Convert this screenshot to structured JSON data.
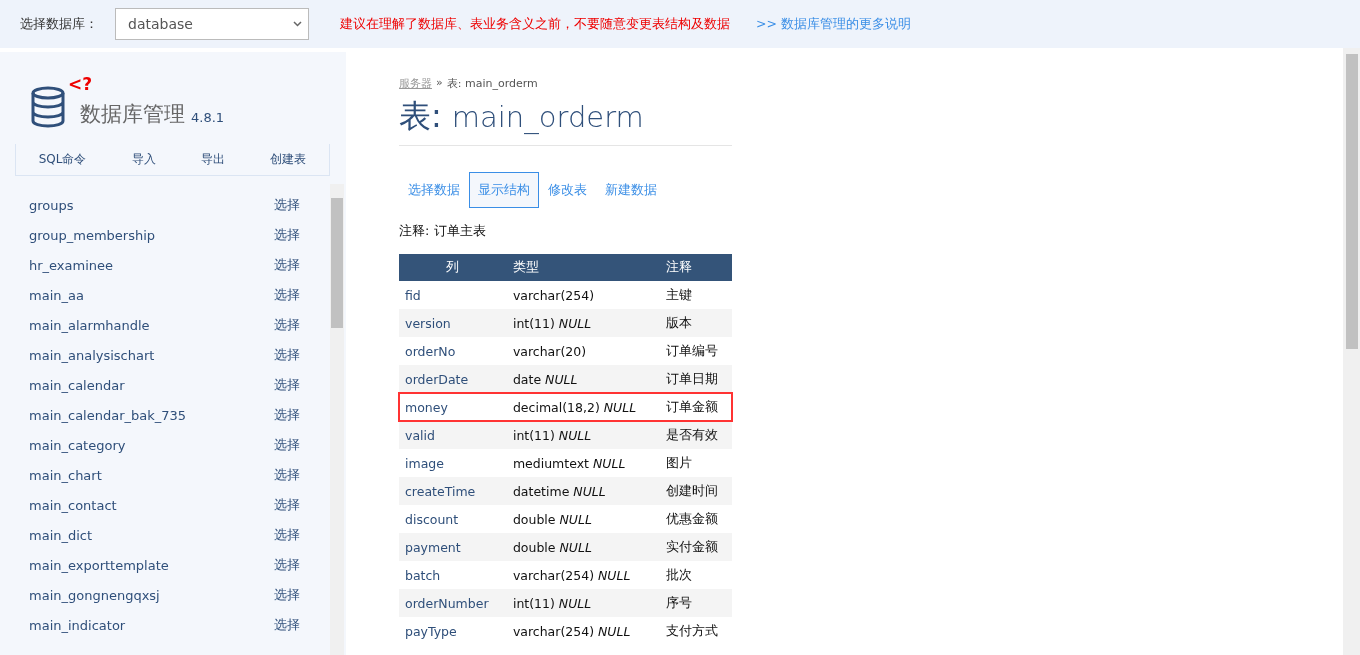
{
  "topbar": {
    "db_label": "选择数据库：",
    "db_select": {
      "value": "database"
    },
    "warning": "建议在理解了数据库、表业务含义之前，不要随意变更表结构及数据",
    "help_link": ">> 数据库管理的更多说明"
  },
  "sidebar": {
    "logo_badge": "<?",
    "title": "数据库管理",
    "version": "4.8.1",
    "actions": [
      "SQL命令",
      "导入",
      "导出",
      "创建表"
    ],
    "tables": [
      {
        "name": "groups",
        "action": "选择"
      },
      {
        "name": "group_membership",
        "action": "选择"
      },
      {
        "name": "hr_examinee",
        "action": "选择"
      },
      {
        "name": "main_aa",
        "action": "选择"
      },
      {
        "name": "main_alarmhandle",
        "action": "选择"
      },
      {
        "name": "main_analysischart",
        "action": "选择"
      },
      {
        "name": "main_calendar",
        "action": "选择"
      },
      {
        "name": "main_calendar_bak_735",
        "action": "选择"
      },
      {
        "name": "main_category",
        "action": "选择"
      },
      {
        "name": "main_chart",
        "action": "选择"
      },
      {
        "name": "main_contact",
        "action": "选择"
      },
      {
        "name": "main_dict",
        "action": "选择"
      },
      {
        "name": "main_exporttemplate",
        "action": "选择"
      },
      {
        "name": "main_gongnengqxsj",
        "action": "选择"
      },
      {
        "name": "main_indicator",
        "action": "选择"
      }
    ]
  },
  "main": {
    "breadcrumb": {
      "link": "服务器",
      "separator": "»",
      "current": "表: main_orderm"
    },
    "title": {
      "prefix": "表:",
      "name": "main_orderm"
    },
    "tabs": [
      {
        "label": "选择数据",
        "selected": false
      },
      {
        "label": "显示结构",
        "selected": true
      },
      {
        "label": "修改表",
        "selected": false
      },
      {
        "label": "新建数据",
        "selected": false
      }
    ],
    "comment": "注释: 订单主表",
    "table": {
      "columns": [
        "列",
        "类型",
        "注释"
      ],
      "rows": [
        {
          "column": "fid",
          "type": "varchar(254)",
          "comment": "主键",
          "highlighted": false
        },
        {
          "column": "version",
          "type": "int(11) *NULL*",
          "comment": "版本",
          "highlighted": false
        },
        {
          "column": "orderNo",
          "type": "varchar(20)",
          "comment": "订单编号",
          "highlighted": false
        },
        {
          "column": "orderDate",
          "type": "date *NULL*",
          "comment": "订单日期",
          "highlighted": false
        },
        {
          "column": "money",
          "type": "decimal(18,2) *NULL*",
          "comment": "订单金额",
          "highlighted": true
        },
        {
          "column": "valid",
          "type": "int(11) *NULL*",
          "comment": "是否有效",
          "highlighted": false
        },
        {
          "column": "image",
          "type": "mediumtext *NULL*",
          "comment": "图片",
          "highlighted": false
        },
        {
          "column": "createTime",
          "type": "datetime *NULL*",
          "comment": "创建时间",
          "highlighted": false
        },
        {
          "column": "discount",
          "type": "double *NULL*",
          "comment": "优惠金额",
          "highlighted": false
        },
        {
          "column": "payment",
          "type": "double *NULL*",
          "comment": "实付金额",
          "highlighted": false
        },
        {
          "column": "batch",
          "type": "varchar(254) *NULL*",
          "comment": "批次",
          "highlighted": false
        },
        {
          "column": "orderNumber",
          "type": "int(11) *NULL*",
          "comment": "序号",
          "highlighted": false
        },
        {
          "column": "payType",
          "type": "varchar(254) *NULL*",
          "comment": "支付方式",
          "highlighted": false
        }
      ]
    }
  }
}
